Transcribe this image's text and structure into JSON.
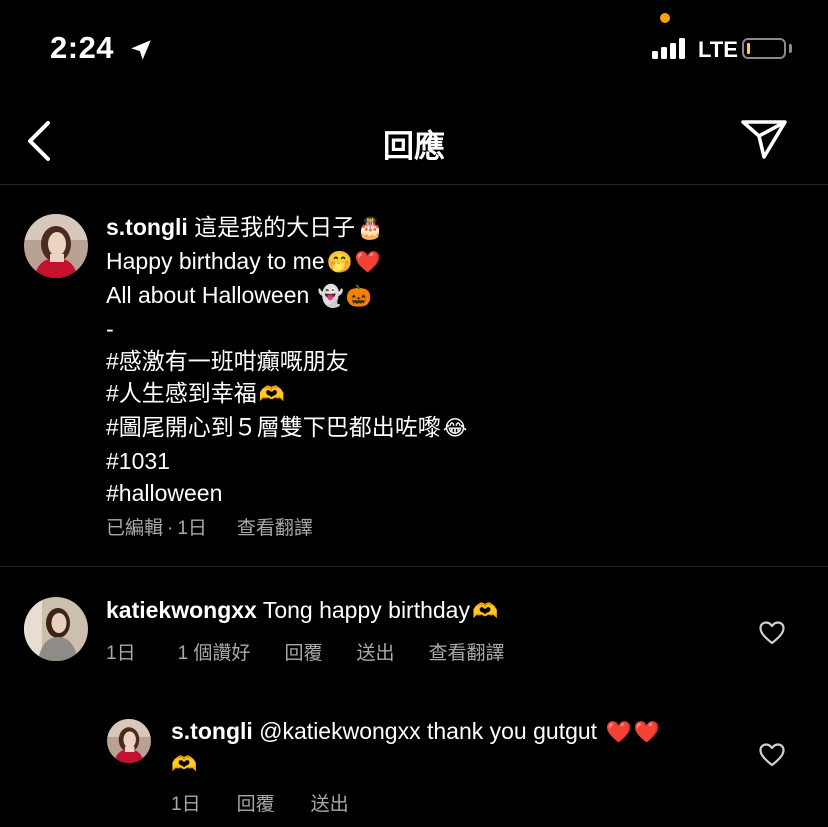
{
  "status_bar": {
    "time": "2:24",
    "network": "LTE",
    "colors": {
      "privacy_dot": "#ff9f0a",
      "battery_level": "#ffd60a"
    },
    "battery_level": 0.08
  },
  "header": {
    "title": "回應"
  },
  "caption": {
    "username": "s.tongli",
    "first_line": "這是我的大日子",
    "lines": [
      "Happy birthday to me",
      "All about Halloween",
      "-",
      "#感激有一班咁癲嘅朋友",
      "#人生感到幸福",
      "#圖尾開心到５層雙下巴都出咗嚟",
      "#1031",
      "#halloween"
    ],
    "emojis": {
      "cake": "🎂",
      "hand_over_mouth": "🤭",
      "heart": "❤️",
      "ghost": "👻",
      "pumpkin": "🎃",
      "heart_hands": "🫶",
      "tears_of_joy": "😂"
    },
    "meta": {
      "edited": "已編輯",
      "age": "1日",
      "translate": "查看翻譯"
    }
  },
  "comments": [
    {
      "username": "katiekwongxx",
      "text": "Tong happy birthday",
      "emoji": "🫶",
      "actions": {
        "age": "1日",
        "likes": "1 個讚好",
        "reply": "回覆",
        "send": "送出",
        "translate": "查看翻譯"
      }
    }
  ],
  "reply": {
    "username": "s.tongli",
    "text": "@katiekwongxx thank you gutgut",
    "emojis": {
      "heart": "❤️",
      "heart_hands": "🫶"
    },
    "actions": {
      "age": "1日",
      "reply": "回覆",
      "send": "送出"
    }
  }
}
